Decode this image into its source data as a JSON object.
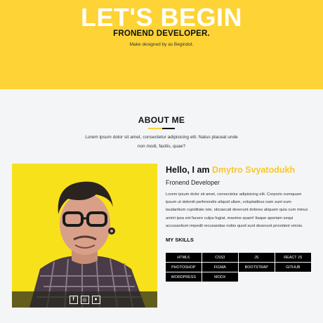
{
  "hero": {
    "title": "LET'S BEGIN",
    "subtitle": "FRONEND DEVELOPER.",
    "credit": "Make designed by as Begindot."
  },
  "about": {
    "heading": "ABOUT ME",
    "description": "Lorem ipsum dolor sit amet, consectetur adipisicing elit. Natus placeat unde non modi, facilis, quae?"
  },
  "profile": {
    "greeting": "Hello, I am ",
    "name": "Dmytro Svyatodukh",
    "role": "Fronend Developer",
    "bio": "Lorem ipsum dolor sit amet, consectetur adipisicing elit. Corporis numquam ipsum ut deleniti perferendis aliquid ullam, voluptatibus nam sunt eum laudantium cupiditate iste, obcaecati deserunt dolores aliquam quia cum minus animi ipsa est facere culpa fugiat, maxime quam! Itaque aperiam sequi accusantium impedit recusandae nobis quod sunt deserunt provident omnis.",
    "photo_icon": "portrait-photo",
    "social": [
      {
        "icon": "facebook-icon",
        "glyph": "f"
      },
      {
        "icon": "instagram-icon",
        "glyph": "◎"
      },
      {
        "icon": "github-icon",
        "glyph": "●"
      }
    ]
  },
  "skills": {
    "title": "MY SKILLS",
    "items": [
      "HTML5",
      "CSS3",
      "JS",
      "REACT JS",
      "PHOTOSHOP",
      "FIGMA",
      "BOOTSTRAP",
      "GITHUB",
      "WORDPRESS",
      "MODX"
    ]
  },
  "colors": {
    "accent": "#fdd335",
    "name": "#f6c92b",
    "skill_bg": "#000000"
  }
}
